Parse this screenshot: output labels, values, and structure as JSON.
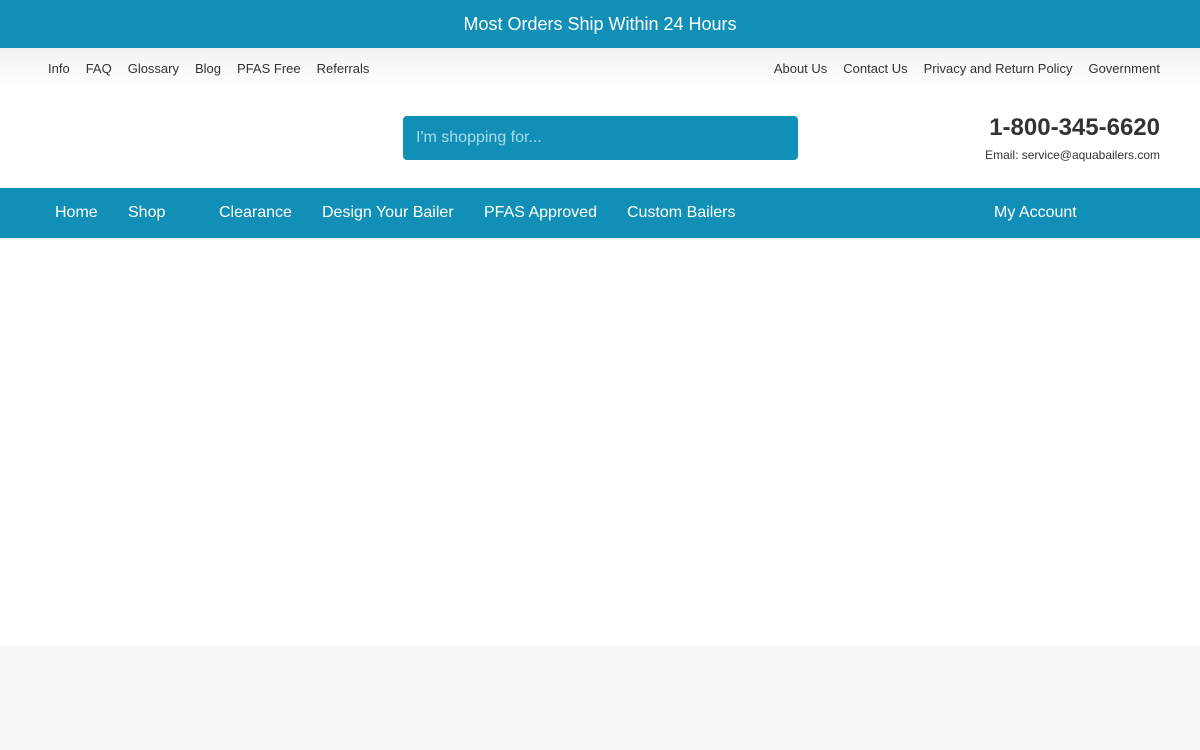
{
  "announcement": {
    "text": "Most Orders Ship Within 24 Hours"
  },
  "utility_nav": {
    "left": [
      "Info",
      "FAQ",
      "Glossary",
      "Blog",
      "PFAS Free",
      "Referrals"
    ],
    "right": [
      "About Us",
      "Contact Us",
      "Privacy and Return Policy",
      "Government"
    ]
  },
  "header": {
    "search_placeholder": "I'm shopping for...",
    "phone": "1-800-345-6620",
    "email": "Email: service@aquabailers.com"
  },
  "main_nav": {
    "items": [
      "Home",
      "Shop",
      "Clearance",
      "Design Your Bailer",
      "PFAS Approved",
      "Custom Bailers"
    ],
    "account": "My Account"
  },
  "colors": {
    "brand": "#118fb6",
    "text": "#333333",
    "footer_bg": "#f5f5f5"
  }
}
